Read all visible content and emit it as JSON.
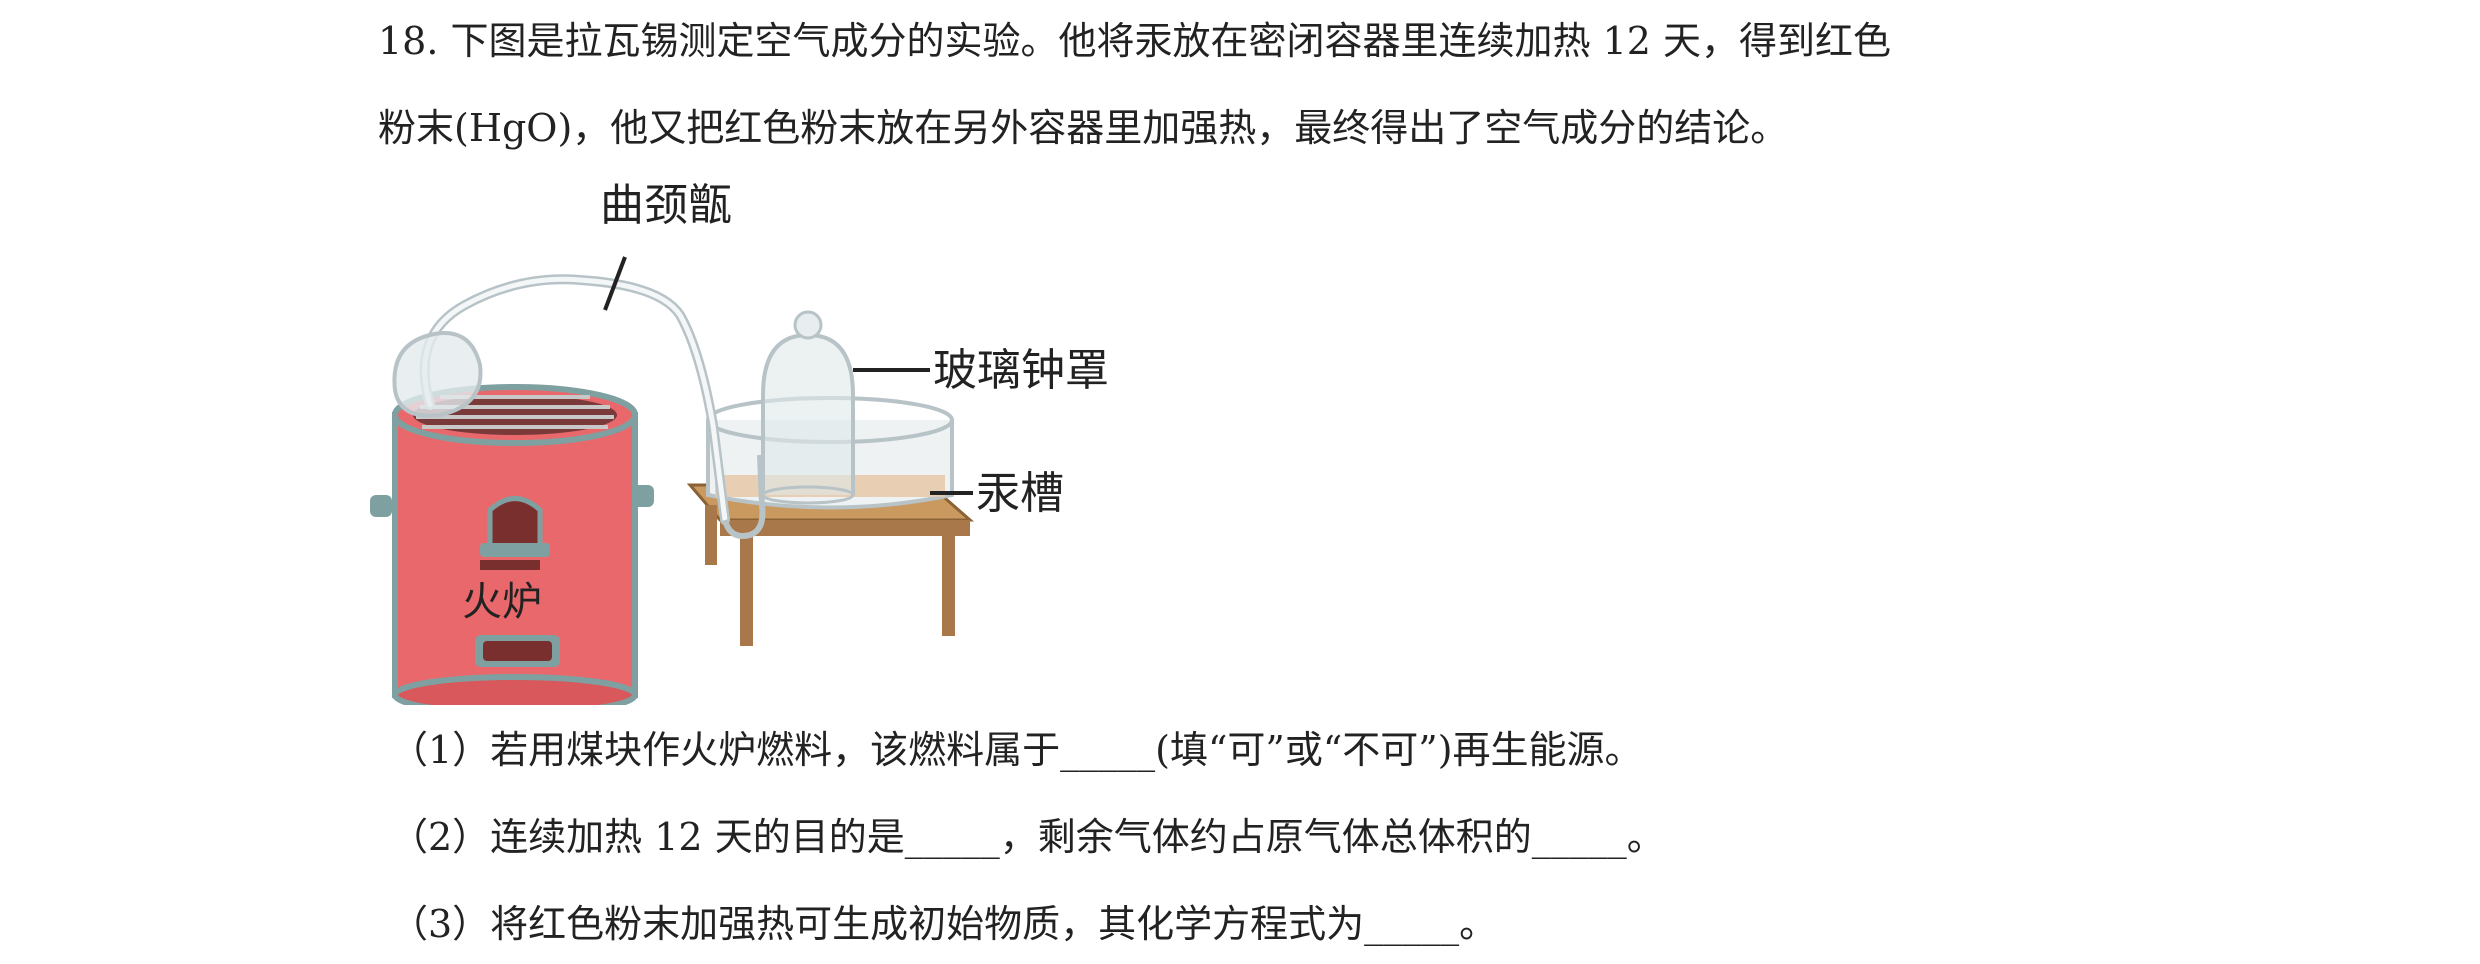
{
  "question": {
    "line1": "18. 下图是拉瓦锡测定空气成分的实验。他将汞放在密闭容器里连续加热 12 天，得到红色",
    "line2": "粉末(HgO)，他又把红色粉末放在另外容器里加强热，最终得出了空气成分的结论。"
  },
  "figure": {
    "label_retort": "曲颈甑",
    "label_bell_jar": "玻璃钟罩",
    "label_mercury_trough": "汞槽",
    "label_furnace": "火炉",
    "colors": {
      "furnace_body": "#e9686b",
      "furnace_rim": "#7fa0a0",
      "table": "#b8874f",
      "glass": "#c8d4d8",
      "mercury": "#e6c9a8"
    }
  },
  "subquestions": {
    "q1": "（1）若用煤块作火炉燃料，该燃料属于_____(填“可”或“不可”)再生能源。",
    "q2": "（2）连续加热 12 天的目的是_____，剩余气体约占原气体总体积的_____。",
    "q3": "（3）将红色粉末加强热可生成初始物质，其化学方程式为_____。"
  }
}
